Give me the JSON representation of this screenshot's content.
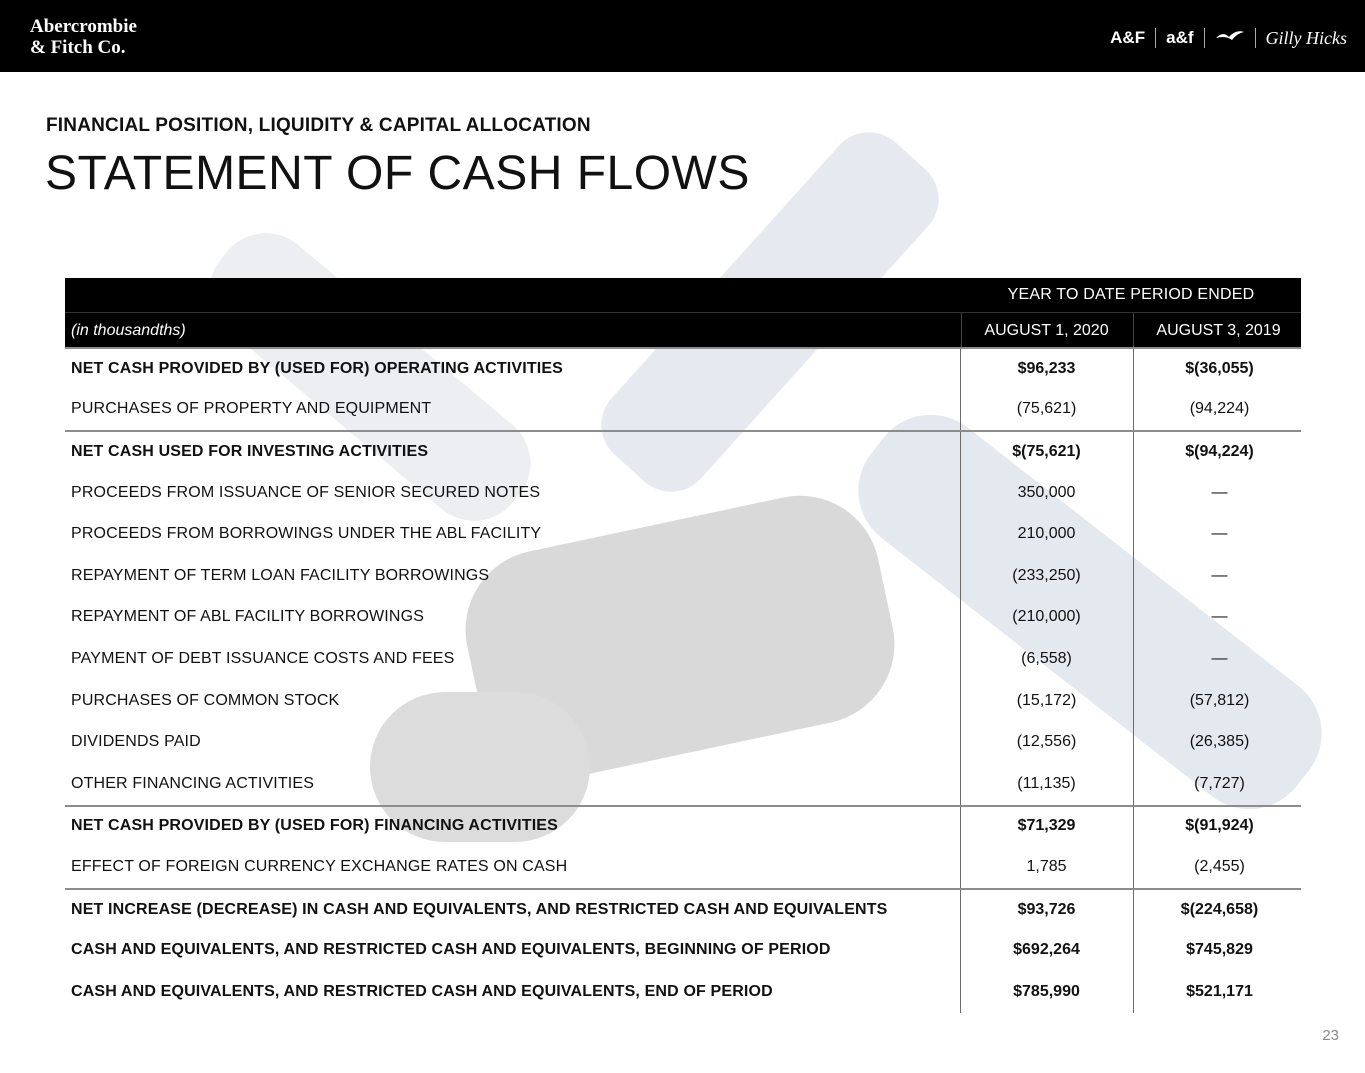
{
  "header": {
    "company_line1": "Abercrombie",
    "company_line2": "& Fitch Co.",
    "brands": [
      "A&F",
      "a&f",
      "Gilly Hicks"
    ],
    "hollister_icon": "seagull-icon"
  },
  "subtitle": "FINANCIAL POSITION, LIQUIDITY & CAPITAL ALLOCATION",
  "title": "STATEMENT OF CASH FLOWS",
  "table": {
    "period_header": "YEAR TO DATE PERIOD ENDED",
    "units": "(in thousandths)",
    "col1": "AUGUST 1, 2020",
    "col2": "AUGUST 3, 2019",
    "rows": [
      {
        "label": "NET CASH PROVIDED BY (USED FOR) OPERATING ACTIVITIES",
        "v1": "$96,233",
        "v2": "$(36,055)",
        "bold": true
      },
      {
        "label": "PURCHASES OF PROPERTY AND EQUIPMENT",
        "v1": "(75,621)",
        "v2": "(94,224)",
        "bold": false
      },
      {
        "label": "NET CASH USED FOR INVESTING ACTIVITIES",
        "v1": "$(75,621)",
        "v2": "$(94,224)",
        "bold": true
      },
      {
        "label": "PROCEEDS FROM ISSUANCE OF SENIOR SECURED NOTES",
        "v1": "350,000",
        "v2": "—",
        "bold": false
      },
      {
        "label": "PROCEEDS FROM BORROWINGS UNDER THE ABL FACILITY",
        "v1": "210,000",
        "v2": "—",
        "bold": false
      },
      {
        "label": "REPAYMENT OF TERM LOAN FACILITY BORROWINGS",
        "v1": "(233,250)",
        "v2": "—",
        "bold": false
      },
      {
        "label": "REPAYMENT OF ABL FACILITY BORROWINGS",
        "v1": "(210,000)",
        "v2": "—",
        "bold": false
      },
      {
        "label": "PAYMENT OF DEBT ISSUANCE COSTS AND FEES",
        "v1": "(6,558)",
        "v2": "—",
        "bold": false
      },
      {
        "label": "PURCHASES OF COMMON STOCK",
        "v1": "(15,172)",
        "v2": "(57,812)",
        "bold": false
      },
      {
        "label": "DIVIDENDS PAID",
        "v1": "(12,556)",
        "v2": "(26,385)",
        "bold": false
      },
      {
        "label": "OTHER FINANCING ACTIVITIES",
        "v1": "(11,135)",
        "v2": "(7,727)",
        "bold": false
      },
      {
        "label": "NET CASH PROVIDED BY (USED FOR) FINANCING ACTIVITIES",
        "v1": "$71,329",
        "v2": "$(91,924)",
        "bold": true
      },
      {
        "label": "EFFECT OF FOREIGN CURRENCY EXCHANGE RATES ON CASH",
        "v1": "1,785",
        "v2": "(2,455)",
        "bold": false
      },
      {
        "label": "NET INCREASE (DECREASE) IN CASH AND EQUIVALENTS, AND RESTRICTED CASH AND EQUIVALENTS",
        "v1": "$93,726",
        "v2": "$(224,658)",
        "bold": true
      },
      {
        "label": "CASH AND EQUIVALENTS, AND RESTRICTED CASH AND EQUIVALENTS, BEGINNING OF PERIOD",
        "v1": "$692,264",
        "v2": "$745,829",
        "bold": true
      },
      {
        "label": "CASH AND EQUIVALENTS, AND RESTRICTED CASH AND EQUIVALENTS, END OF PERIOD",
        "v1": "$785,990",
        "v2": "$521,171",
        "bold": true
      }
    ]
  },
  "page_number": "23"
}
